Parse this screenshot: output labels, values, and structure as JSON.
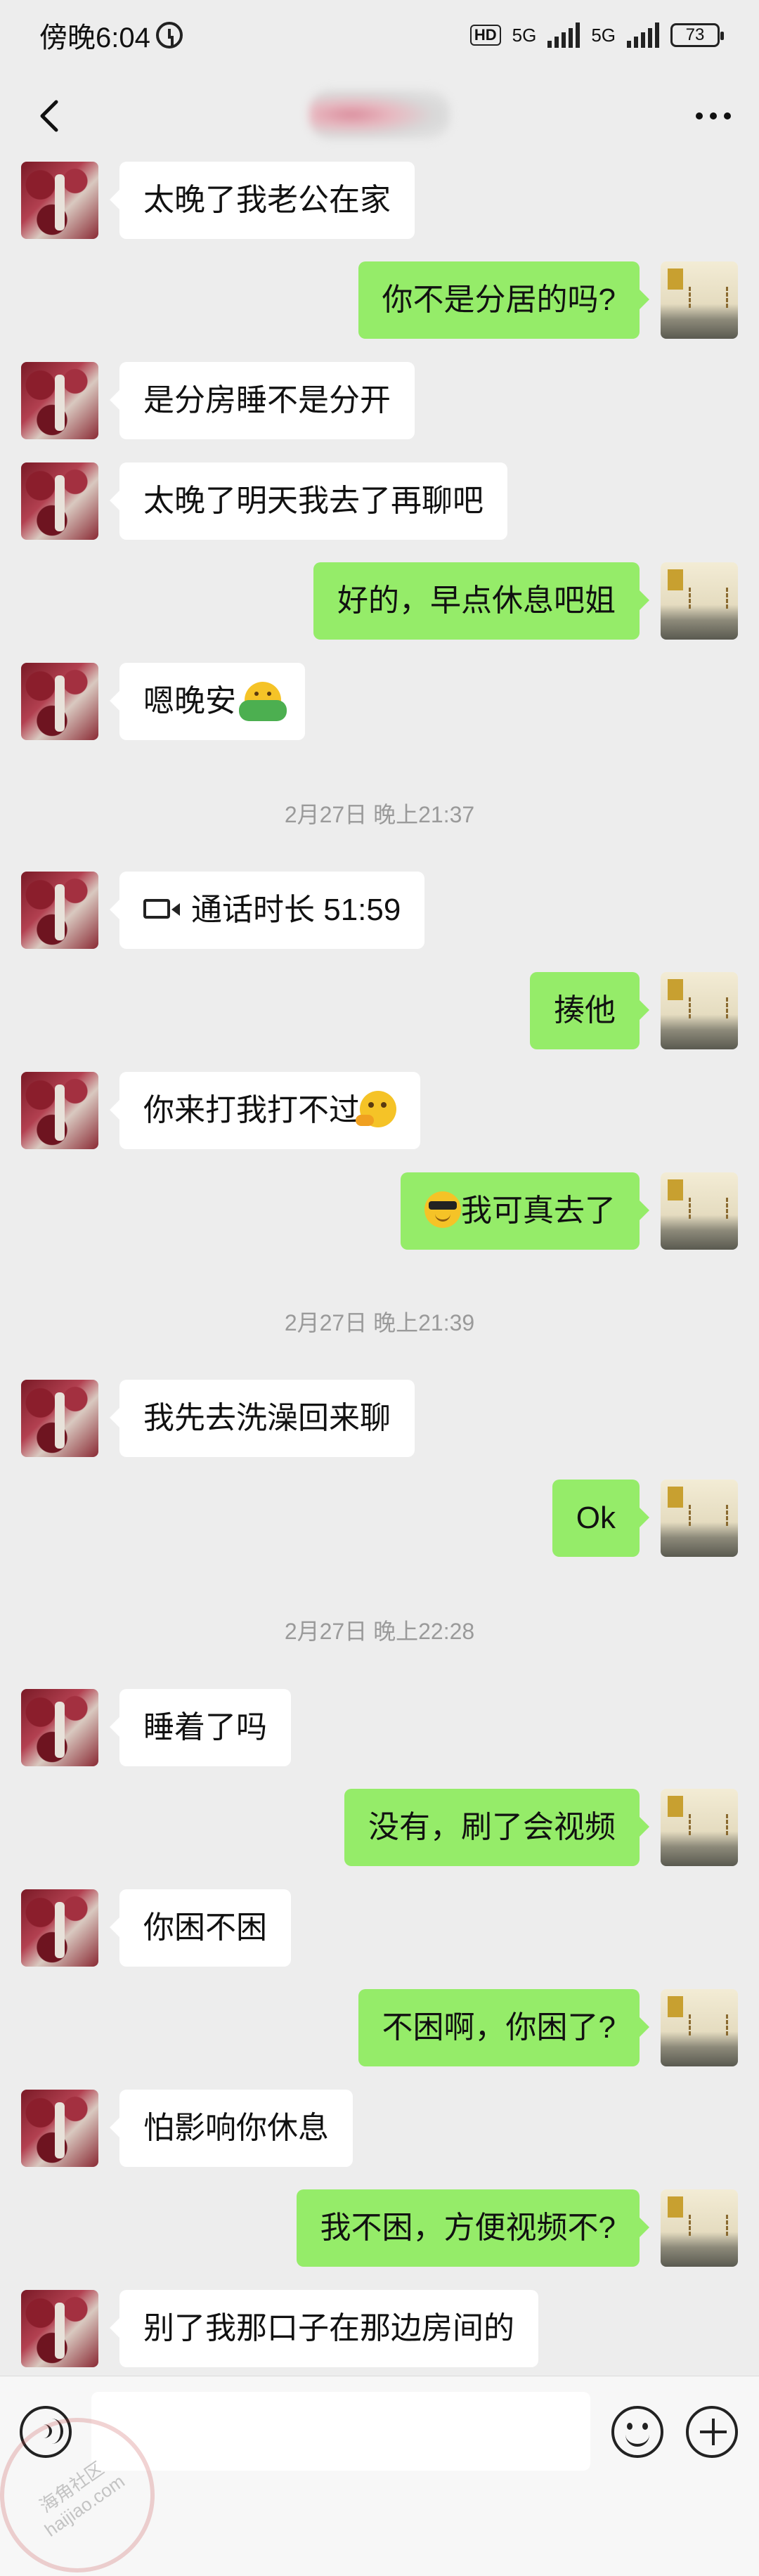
{
  "status_bar": {
    "time": "傍晚6:04",
    "network_1": "5G",
    "network_2": "5G",
    "hd": "HD",
    "battery": "73"
  },
  "header": {
    "back_icon": "chevron-left-icon",
    "more_icon": "more-dots-icon"
  },
  "messages": [
    {
      "side": "in",
      "text": "太晚了我老公在家"
    },
    {
      "side": "out",
      "text": "你不是分居的吗?"
    },
    {
      "side": "in",
      "text": "是分房睡不是分开"
    },
    {
      "side": "in",
      "text": "太晚了明天我去了再聊吧"
    },
    {
      "side": "out",
      "text": "好的，早点休息吧姐"
    },
    {
      "side": "in",
      "text": "嗯晚安",
      "emoji": "hug"
    },
    {
      "type": "time",
      "text": "2月27日 晚上21:37"
    },
    {
      "side": "in",
      "text": "通话时长 51:59",
      "icon": "video-call-icon"
    },
    {
      "side": "out",
      "text": "揍他"
    },
    {
      "side": "in",
      "text": "你来打我打不过",
      "emoji": "think"
    },
    {
      "side": "out",
      "text": "我可真去了",
      "emoji_before": "cool"
    },
    {
      "type": "time",
      "text": "2月27日 晚上21:39"
    },
    {
      "side": "in",
      "text": "我先去洗澡回来聊"
    },
    {
      "side": "out",
      "text": "Ok"
    },
    {
      "type": "time",
      "text": "2月27日 晚上22:28"
    },
    {
      "side": "in",
      "text": "睡着了吗"
    },
    {
      "side": "out",
      "text": "没有，刷了会视频"
    },
    {
      "side": "in",
      "text": "你困不困"
    },
    {
      "side": "out",
      "text": "不困啊，你困了?"
    },
    {
      "side": "in",
      "text": "怕影响你休息"
    },
    {
      "side": "out",
      "text": "我不困，方便视频不?"
    },
    {
      "side": "in",
      "text": "别了我那口子在那边房间的"
    }
  ],
  "input_bar": {
    "voice_icon": "voice-icon",
    "emoji_icon": "emoji-icon",
    "plus_icon": "plus-icon"
  },
  "watermark": {
    "line1": "海角社区",
    "line2": "haijiao.com"
  }
}
